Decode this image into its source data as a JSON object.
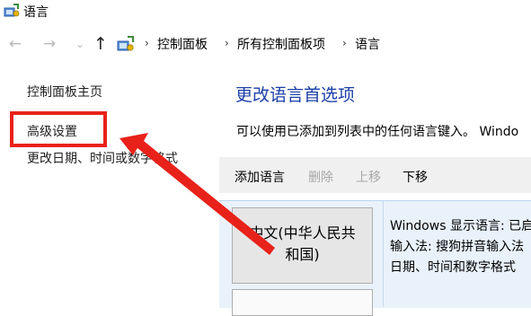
{
  "window": {
    "title": "语言"
  },
  "nav": {
    "back": "←",
    "forward": "→",
    "recent": "⌄",
    "up": "↑",
    "breadcrumb_sep": "›",
    "breadcrumb": [
      "控制面板",
      "所有控制面板项",
      "语言"
    ]
  },
  "sidebar": {
    "home": "控制面板主页",
    "advanced": "高级设置",
    "datetime": "更改日期、时间或数字格式"
  },
  "main": {
    "title": "更改语言首选项",
    "description": "可以使用已添加到列表中的任何语言键入。 Windo"
  },
  "toolbar": {
    "add": "添加语言",
    "remove": "删除",
    "move_up": "上移",
    "move_down": "下移"
  },
  "languages": [
    {
      "name_line1": "中文(中华人民共",
      "name_line2": "和国)",
      "details": [
        "Windows 显示语言: 已启",
        "输入法: 搜狗拼音输入法",
        "日期、时间和数字格式"
      ]
    }
  ],
  "colors": {
    "annotation": "#e8221a",
    "link_title": "#1b3fa8",
    "list_selected_bg": "#e9f2fb"
  },
  "icons": {
    "title": "control-panel-icon",
    "address": "control-panel-icon",
    "annotation": "red-arrow"
  }
}
